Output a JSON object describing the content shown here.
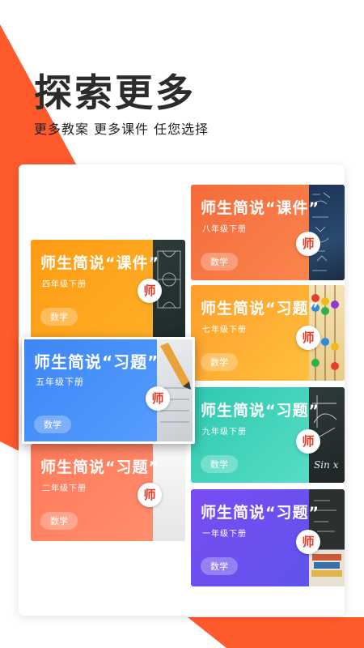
{
  "hero": {
    "title": "探索更多",
    "subtitle": "更多教案 更多课件 任您选择"
  },
  "colors": {
    "accent": "#ff5a2c",
    "badge_text": "#e53820"
  },
  "badge_icon": "teacher-logo-icon",
  "cards": [
    {
      "title": "师生简说“课件”",
      "grade": "八年级下册",
      "subject": "数学",
      "badge": "师",
      "photo": "math-formulas"
    },
    {
      "title": "师生简说“课件”",
      "grade": "四年级下册",
      "subject": "数学",
      "badge": "师",
      "photo": "basketball-court-chalkboard"
    },
    {
      "title": "师生简说“习题”",
      "grade": "七年级下册",
      "subject": "数学",
      "badge": "师",
      "photo": "abacus"
    },
    {
      "title": "师生简说“习题”",
      "grade": "五年级下册",
      "subject": "数学",
      "badge": "师",
      "photo": "pencil-and-paper"
    },
    {
      "title": "师生简说“习题”",
      "grade": "九年级下册",
      "subject": "数学",
      "badge": "师",
      "photo": "trigonometry-chalkboard"
    },
    {
      "title": "师生简说“习题”",
      "grade": "二年级下册",
      "subject": "数学",
      "badge": "师",
      "photo": "white-desk"
    },
    {
      "title": "师生简说“习题”",
      "grade": "一年级下册",
      "subject": "数学",
      "badge": "师",
      "photo": "books-and-blackboard"
    }
  ]
}
